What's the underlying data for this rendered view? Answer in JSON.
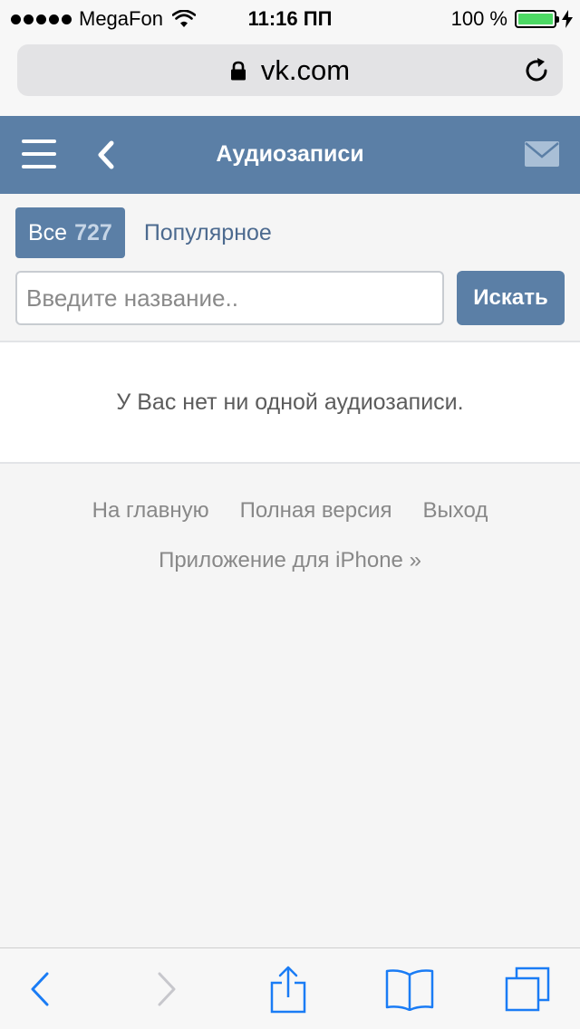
{
  "status_bar": {
    "carrier": "MegaFon",
    "time": "11:16 ПП",
    "battery_percent": "100 %",
    "battery_level": 1.0,
    "signal_bars": 5,
    "icons": [
      "signal-dots-icon",
      "wifi-icon",
      "battery-icon",
      "charging-bolt-icon"
    ]
  },
  "browser": {
    "address": "vk.com",
    "icons": [
      "lock-icon",
      "reload-icon"
    ]
  },
  "header": {
    "title": "Аудиозаписи",
    "icons": [
      "menu-icon",
      "back-arrow-icon",
      "mail-icon"
    ]
  },
  "tabs": {
    "all_label": "Все",
    "all_count": "727",
    "popular_label": "Популярное"
  },
  "search": {
    "placeholder": "Введите название..",
    "value": "",
    "button_label": "Искать"
  },
  "empty_message": "У Вас нет ни одной аудиозаписи.",
  "footer": {
    "links": [
      "На главную",
      "Полная версия",
      "Выход"
    ],
    "app_link": "Приложение для iPhone »"
  },
  "toolbar": {
    "icons": [
      "back-icon",
      "forward-icon",
      "share-icon",
      "bookmarks-icon",
      "tabs-icon"
    ]
  },
  "colors": {
    "vk_blue": "#5b7fa6",
    "link_blue": "#4c6a8f",
    "ios_blue": "#1a7cf5",
    "battery_green": "#4cd964"
  }
}
